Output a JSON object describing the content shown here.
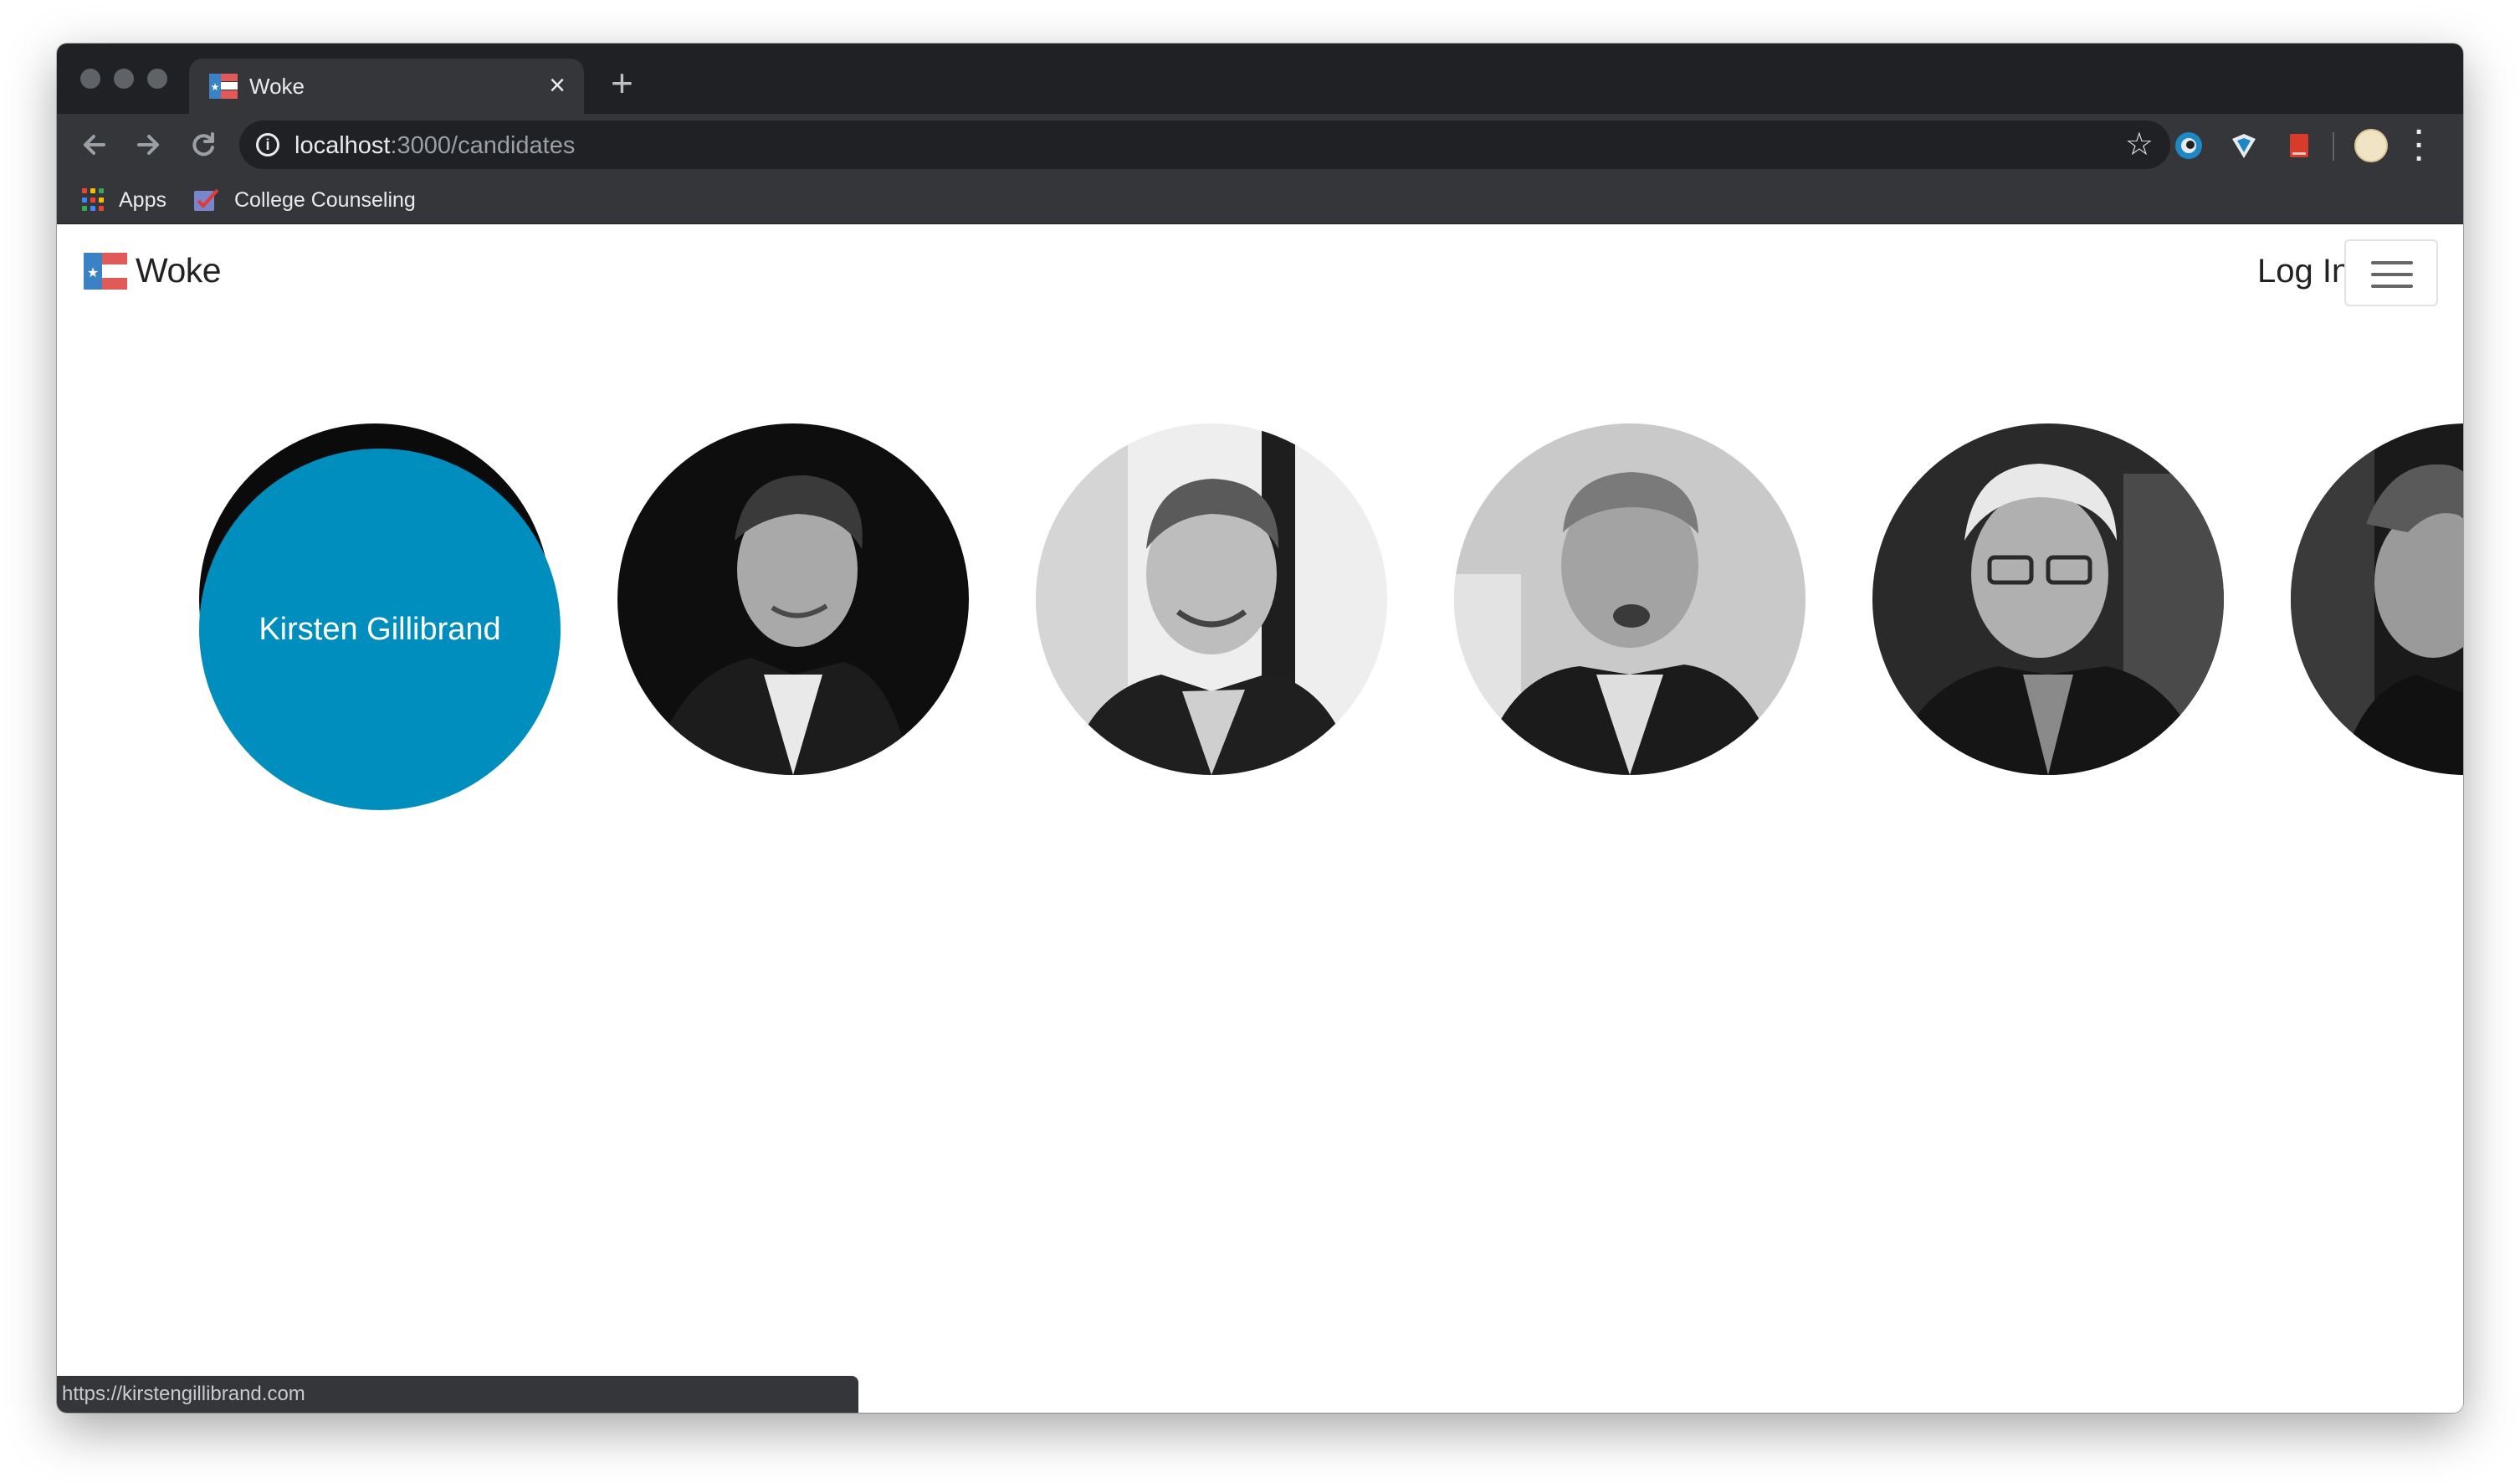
{
  "browser": {
    "tab_title": "Woke",
    "tab_close": "×",
    "new_tab": "+",
    "url_host": "localhost",
    "url_path": ":3000/candidates",
    "icons": [
      "back-icon",
      "forward-icon",
      "reload-icon",
      "info-icon",
      "star-icon",
      "extension-icon",
      "profile-avatar",
      "menu-icon"
    ],
    "bookmarks": [
      {
        "label": "Apps",
        "icon": "apps-grid-icon"
      },
      {
        "label": "College Counseling",
        "icon": "checkbox-icon"
      }
    ],
    "status_url": "https://kirstengillibrand.com"
  },
  "site": {
    "brand_name": "Woke",
    "login_label": "Log In",
    "accent_color": "#008ebe"
  },
  "candidates": [
    {
      "name": "Kirsten Gillibrand",
      "state": "hovered"
    },
    {
      "name": "",
      "state": "photo"
    },
    {
      "name": "",
      "state": "photo"
    },
    {
      "name": "",
      "state": "photo"
    },
    {
      "name": "",
      "state": "photo"
    },
    {
      "name": "",
      "state": "photo-partial"
    }
  ]
}
